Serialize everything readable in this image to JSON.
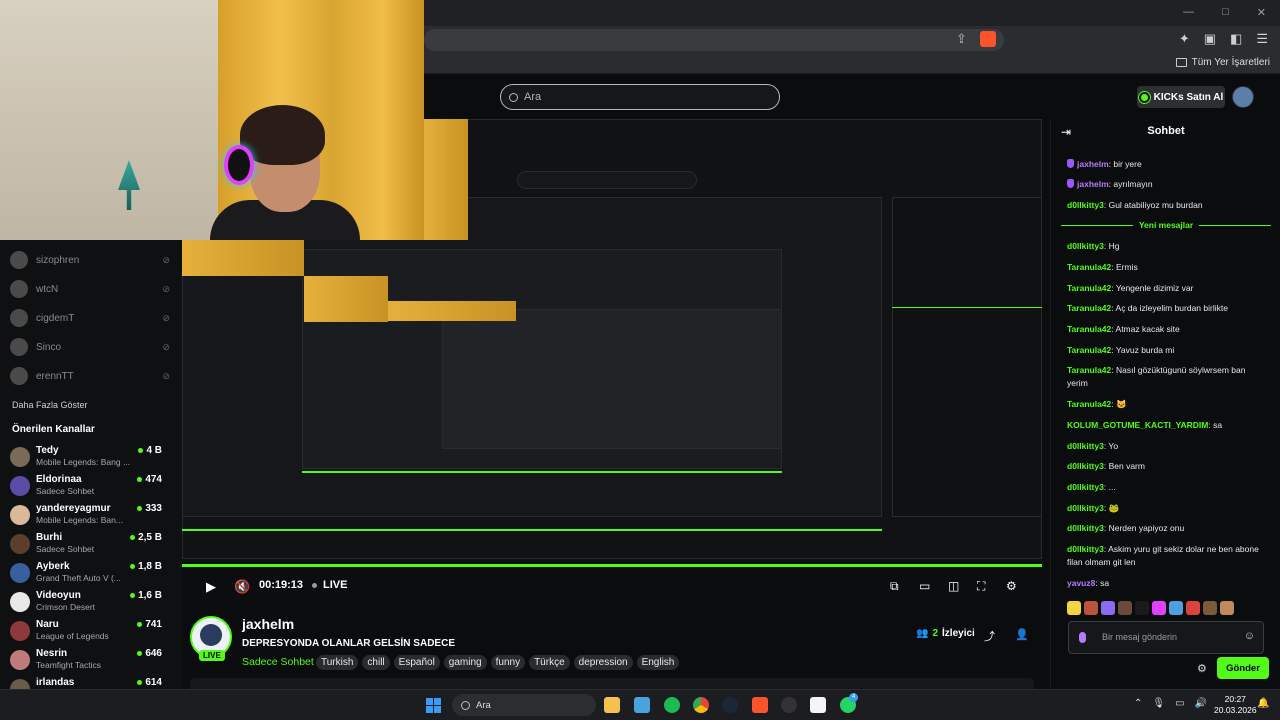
{
  "browser": {
    "bookmarks_all": "Tüm Yer İşaretleri"
  },
  "header": {
    "search_placeholder": "Ara",
    "kicks_button": "KICKs Satın Al"
  },
  "sidebar": {
    "followed": [
      {
        "name": "sizophren"
      },
      {
        "name": "wtcN"
      },
      {
        "name": "cigdemT"
      },
      {
        "name": "Sinco"
      },
      {
        "name": "erennTT"
      }
    ],
    "show_more": "Daha Fazla Göster",
    "recommended_title": "Önerilen Kanallar",
    "recommended": [
      {
        "name": "Tedy",
        "category": "Mobile Legends: Bang ...",
        "viewers": "4 B"
      },
      {
        "name": "Eldorinaa",
        "category": "Sadece Sohbet",
        "viewers": "474"
      },
      {
        "name": "yandereyagmur",
        "category": "Mobile Legends: Ban...",
        "viewers": "333"
      },
      {
        "name": "Burhi",
        "category": "Sadece Sohbet",
        "viewers": "2,5 B"
      },
      {
        "name": "Ayberk",
        "category": "Grand Theft Auto V (...",
        "viewers": "1,8 B"
      },
      {
        "name": "Videoyun",
        "category": "Crimson Desert",
        "viewers": "1,6 B"
      },
      {
        "name": "Naru",
        "category": "League of Legends",
        "viewers": "741"
      },
      {
        "name": "Nesrin",
        "category": "Teamfight Tactics",
        "viewers": "646"
      },
      {
        "name": "irlandas",
        "category": "",
        "viewers": "614"
      }
    ]
  },
  "player": {
    "time": "00:19:13",
    "live": "LIVE"
  },
  "stream": {
    "live_badge": "LIVE",
    "streamer": "jaxhelm",
    "title": "DEPRESYONDA OLANLAR GELSİN SADECE",
    "category": "Sadece Sohbet",
    "tags": [
      "Turkish",
      "chill",
      "Español",
      "gaming",
      "funny",
      "Türkçe",
      "depression",
      "English"
    ],
    "viewers_count": "2",
    "viewers_label": "İzleyici"
  },
  "chat": {
    "title": "Sohbet",
    "messages_before": [
      {
        "user": "jaxhelm",
        "text": ": bir yere",
        "purple": true
      },
      {
        "user": "jaxhelm",
        "text": ": ayrılmayın",
        "purple": true
      },
      {
        "user": "d0llkitty3",
        "text": ": Gul atabiliyoz mu burdan",
        "purple": false
      }
    ],
    "new_messages_label": "Yeni mesajlar",
    "messages_after": [
      {
        "user": "d0llkitty3",
        "text": ": Hg"
      },
      {
        "user": "Taranula42",
        "text": ": Ermis"
      },
      {
        "user": "Taranula42",
        "text": ": Yengenle dizimiz var"
      },
      {
        "user": "Taranula42",
        "text": ": Aç da izleyelim burdan birlikte"
      },
      {
        "user": "Taranula42",
        "text": ": Atmaz kacak site"
      },
      {
        "user": "Taranula42",
        "text": ": Yavuz burda mi"
      },
      {
        "user": "Taranula42",
        "text": ": Nasıl gözüktügunü söylwrsem ban yerim"
      },
      {
        "user": "Taranula42",
        "text": ": 🐱"
      },
      {
        "user": "KOLUM_GOTUME_KACTI_YARDIM",
        "text": ": sa"
      },
      {
        "user": "d0llkitty3",
        "text": ": Yo"
      },
      {
        "user": "d0llkitty3",
        "text": ": Ben varm"
      },
      {
        "user": "d0llkitty3",
        "text": ": ..."
      },
      {
        "user": "d0llkitty3",
        "text": ": 🐸"
      },
      {
        "user": "d0llkitty3",
        "text": ": Nerden yapiyoz onu"
      },
      {
        "user": "d0llkitty3",
        "text": ": Askim yuru git sekiz dolar ne ben abone filan olmam git len"
      },
      {
        "user": "yavuz8",
        "text": ": sa"
      }
    ],
    "input_placeholder": "Bir mesaj gönderin",
    "send_button": "Gönder"
  },
  "taskbar": {
    "search": "Ara",
    "time": "20:27",
    "date": "20.03.2026",
    "whatsapp_badge": "4"
  },
  "colors": {
    "accent": "#53fc18",
    "mod_badge": "#9b57f5",
    "background": "#0b0c0e"
  }
}
